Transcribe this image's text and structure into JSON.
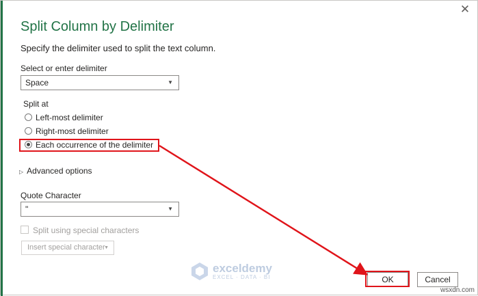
{
  "dialog": {
    "title": "Split Column by Delimiter",
    "description": "Specify the delimiter used to split the text column.",
    "close_icon": "close-icon"
  },
  "delimiter": {
    "label": "Select or enter delimiter",
    "value": "Space"
  },
  "split_at": {
    "label": "Split at",
    "options": [
      {
        "label": "Left-most delimiter",
        "checked": false
      },
      {
        "label": "Right-most delimiter",
        "checked": false
      },
      {
        "label": "Each occurrence of the delimiter",
        "checked": true
      }
    ]
  },
  "advanced": {
    "label": "Advanced options"
  },
  "quote": {
    "label": "Quote Character",
    "value": "\""
  },
  "special": {
    "checkbox_label": "Split using special characters",
    "insert_label": "Insert special character"
  },
  "buttons": {
    "ok": "OK",
    "cancel": "Cancel"
  },
  "watermark": {
    "name": "exceldemy",
    "sub": "EXCEL · DATA · BI"
  },
  "footer": {
    "url": "wsxdn.com"
  },
  "colors": {
    "accent": "#217346",
    "highlight": "#e0141a"
  }
}
